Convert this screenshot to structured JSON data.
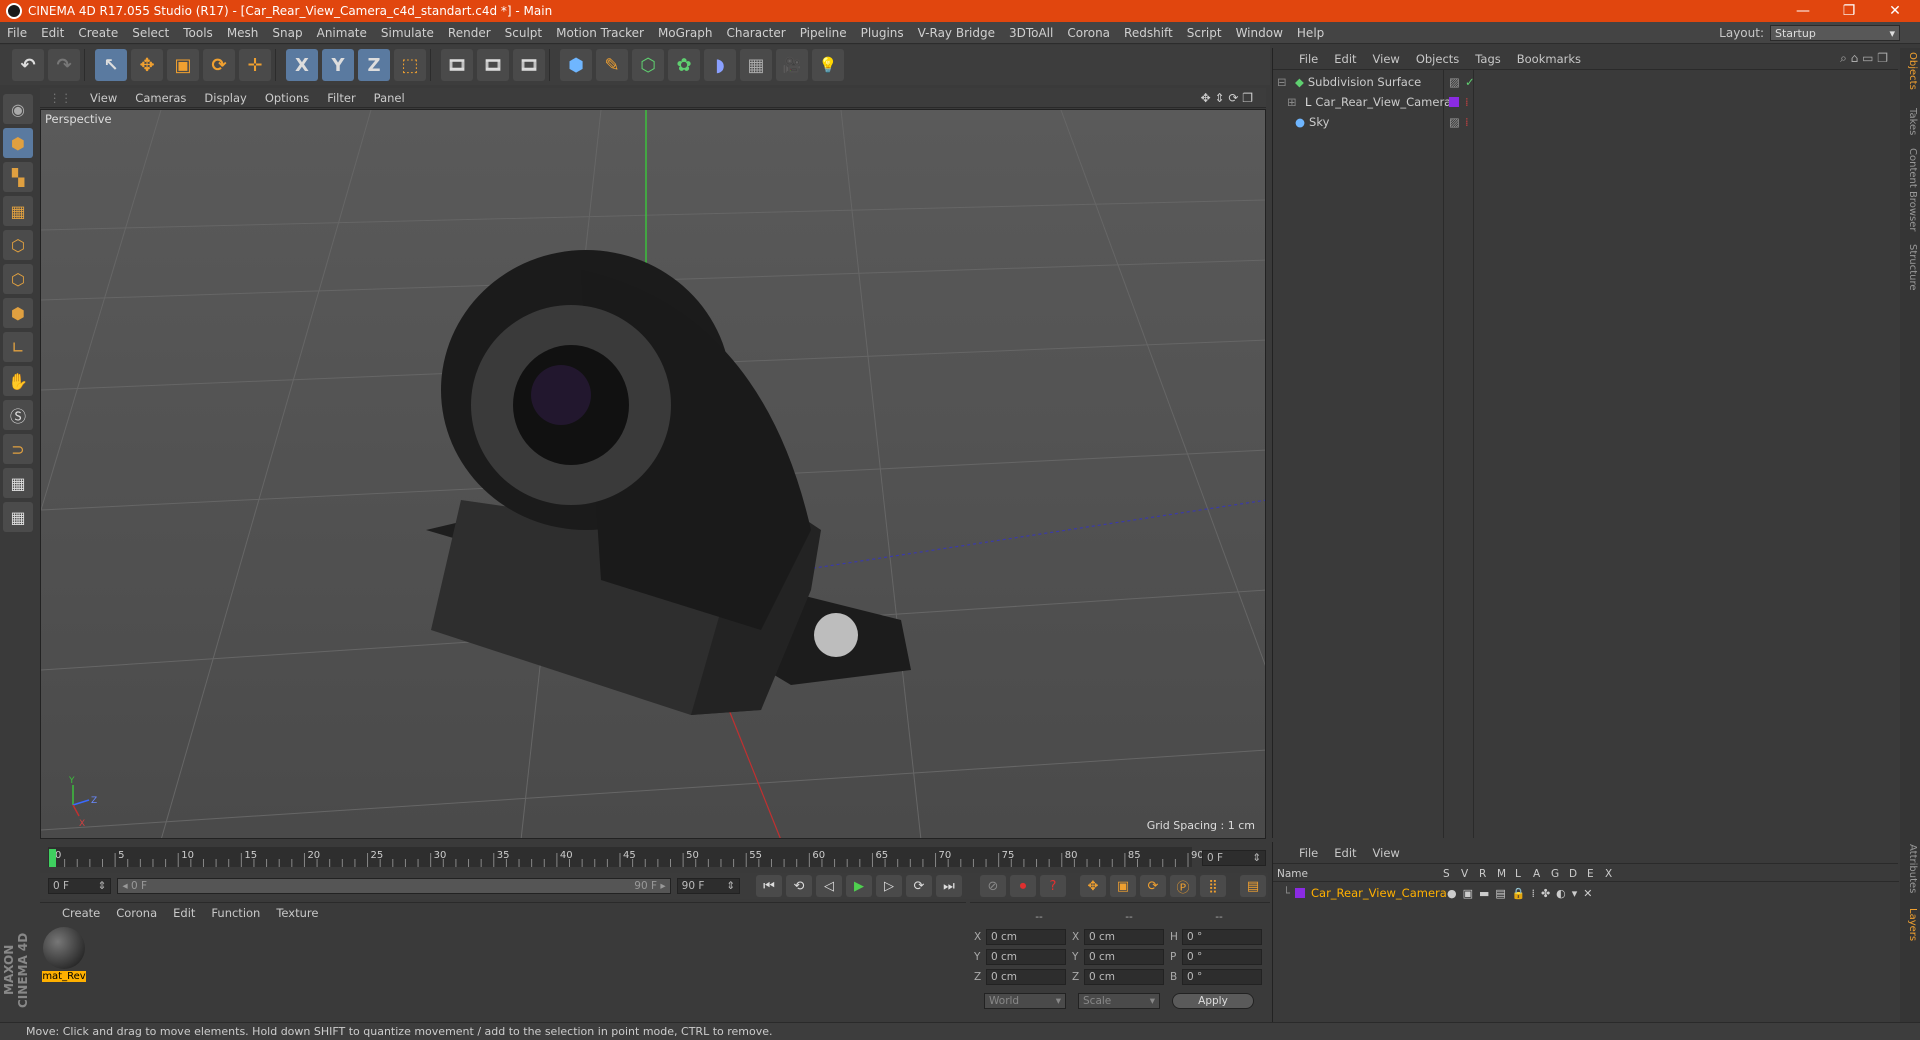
{
  "titlebar": {
    "title": "CINEMA 4D R17.055 Studio (R17) - [Car_Rear_View_Camera_c4d_standart.c4d *] - Main",
    "minimize": "—",
    "maximize": "❐",
    "close": "✕"
  },
  "menubar": {
    "items": [
      "File",
      "Edit",
      "Create",
      "Select",
      "Tools",
      "Mesh",
      "Snap",
      "Animate",
      "Simulate",
      "Render",
      "Sculpt",
      "Motion Tracker",
      "MoGraph",
      "Character",
      "Pipeline",
      "Plugins",
      "V-Ray Bridge",
      "3DToAll",
      "Corona",
      "Redshift",
      "Script",
      "Window",
      "Help"
    ],
    "layout_label": "Layout:",
    "layout_value": "Startup"
  },
  "toolbar": {
    "undo": "↶",
    "redo": "↷",
    "live_select": "↖",
    "move": "✥",
    "scale": "▣",
    "rotate": "⟳",
    "recent": "✛",
    "x": "X",
    "y": "Y",
    "z": "Z",
    "coord": "⬚",
    "render_view": "🎞",
    "render": "🎞",
    "render_settings": "🎞",
    "cube": "⬢",
    "pen": "✎",
    "subdiv": "⬡",
    "array": "✿",
    "deformer": "◗",
    "floor": "▦",
    "camera": "🎥",
    "light": "💡"
  },
  "viewport": {
    "menu": [
      "View",
      "Cameras",
      "Display",
      "Options",
      "Filter",
      "Panel"
    ],
    "label": "Perspective",
    "grid_spacing": "Grid Spacing : 1 cm",
    "axis_y": "Y",
    "axis_z": "Z",
    "axis_x": "X"
  },
  "timeline": {
    "ticks": [
      "0",
      "5",
      "10",
      "15",
      "20",
      "25",
      "30",
      "35",
      "40",
      "45",
      "50",
      "55",
      "60",
      "65",
      "70",
      "75",
      "80",
      "85",
      "90"
    ],
    "end_field": "0 F",
    "current_frame": 0,
    "max_frame": 90
  },
  "transport": {
    "start_field": "0 F",
    "range_start": "◂ 0 F",
    "range_end": "90 F ▸",
    "end_field": "90 F"
  },
  "material_manager": {
    "menu": [
      "Create",
      "Corona",
      "Edit",
      "Function",
      "Texture"
    ],
    "material_name": "mat_Rev"
  },
  "coordinates": {
    "header": [
      "--",
      "--",
      "--"
    ],
    "rows": [
      {
        "a": "X",
        "av": "0 cm",
        "b": "X",
        "bv": "0 cm",
        "c": "H",
        "cv": "0 °"
      },
      {
        "a": "Y",
        "av": "0 cm",
        "b": "Y",
        "bv": "0 cm",
        "c": "P",
        "cv": "0 °"
      },
      {
        "a": "Z",
        "av": "0 cm",
        "b": "Z",
        "bv": "0 cm",
        "c": "B",
        "cv": "0 °"
      }
    ],
    "mode1": "World",
    "mode2": "Scale",
    "apply": "Apply"
  },
  "object_manager": {
    "menu": [
      "File",
      "Edit",
      "View",
      "Objects",
      "Tags",
      "Bookmarks"
    ],
    "objects": [
      {
        "name": "Subdivision Surface",
        "color": "#cfcfcf"
      },
      {
        "name": "Car_Rear_View_Camera",
        "color": "#cfcfcf"
      },
      {
        "name": "Sky",
        "color": "#cfcfcf"
      }
    ]
  },
  "layers": {
    "menu": [
      "File",
      "Edit",
      "View"
    ],
    "columns": [
      "Name",
      "S",
      "V",
      "R",
      "M",
      "L",
      "A",
      "G",
      "D",
      "E",
      "X"
    ],
    "row_name": "Car_Rear_View_Camera"
  },
  "right_tabs": [
    "Objects",
    "Takes",
    "Content Browser",
    "Structure",
    "Attributes",
    "Layers"
  ],
  "statusbar": {
    "text": "Move: Click and drag to move elements. Hold down SHIFT to quantize movement / add to the selection in point mode, CTRL to remove."
  },
  "brand": "MAXON CINEMA 4D",
  "colors": {
    "title_bar": "#e1460e",
    "accent": "#5a7aa0",
    "layer_purple": "#8a2be2",
    "highlight": "#ffb000"
  }
}
